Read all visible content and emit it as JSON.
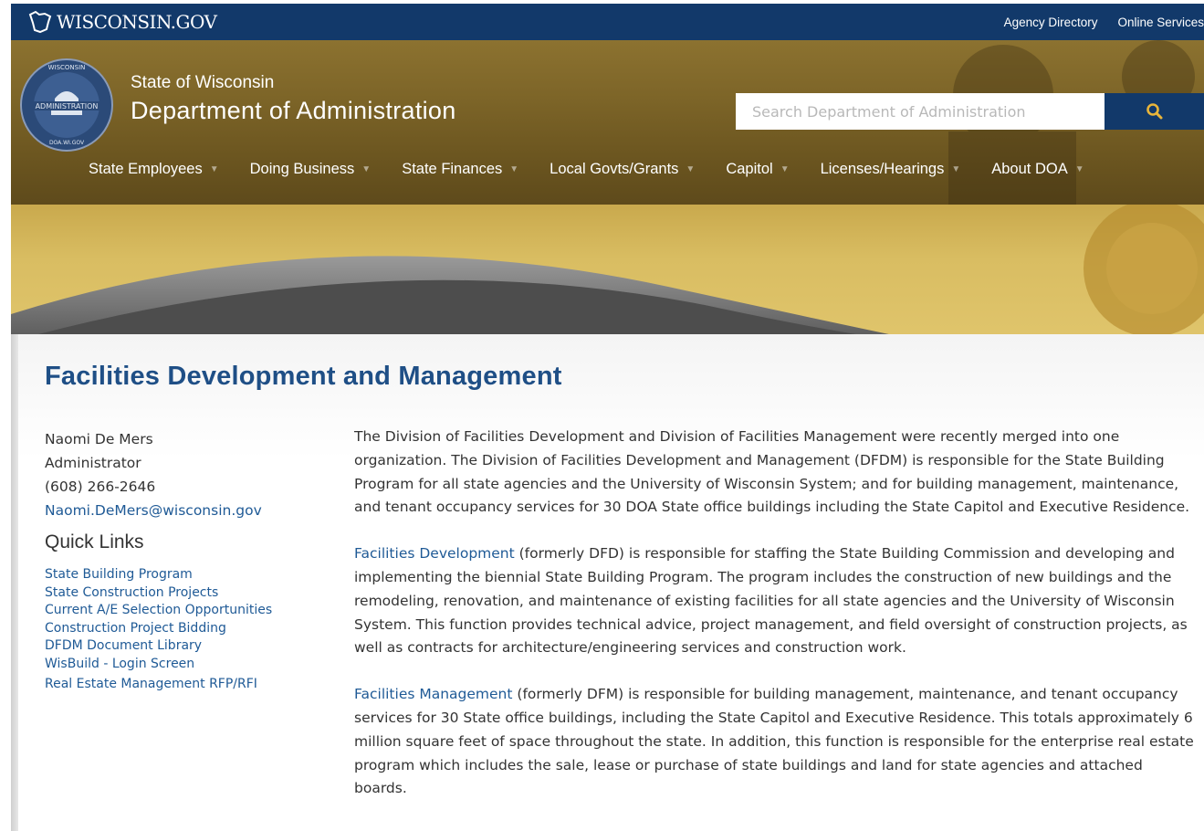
{
  "topbar": {
    "logo_text": "WISCONSIN.GOV",
    "links": [
      "Agency Directory",
      "Online Services"
    ]
  },
  "header": {
    "agency_small": "State of Wisconsin",
    "agency_big": "Department of Administration",
    "seal_text_top": "WISCONSIN",
    "seal_text_mid": "ADMINISTRATION",
    "seal_text_bottom": "DOA.WI.GOV",
    "search_placeholder": "Search Department of Administration",
    "nav": [
      {
        "label": "State Employees"
      },
      {
        "label": "Doing Business"
      },
      {
        "label": "State Finances"
      },
      {
        "label": "Local Govts/Grants"
      },
      {
        "label": "Capitol"
      },
      {
        "label": "Licenses/Hearings"
      },
      {
        "label": "About DOA"
      }
    ]
  },
  "page": {
    "title": "Facilities Development and Management"
  },
  "contact": {
    "name": "Naomi De Mers",
    "role": "Administrator",
    "phone": "(608) 266-2646",
    "email": "Naomi.DeMers@wisconsin.gov"
  },
  "quick_links": {
    "title": "Quick Links",
    "items": [
      "State Building Program",
      "State Construction Projects",
      "Current A/E Selection Opportunities",
      "Construction Project Bidding",
      "DFDM Document Library",
      "WisBuild - Login Screen",
      "Real Estate Management RFP/RFI"
    ]
  },
  "body": {
    "p1": "The Division of Facilities Development and Division of Facilities Management were recently merged into one organization. The Division of Facilities Development and Management (DFDM) is responsible for the State Building Program for all state agencies and the University of Wisconsin System; and for building management, maintenance, and tenant occupancy services for 30 DOA State office buildings including the State Capitol and Executive Residence.",
    "p2_link": "Facilities Development",
    "p2_rest": " (formerly DFD) is responsible for staffing the State Building Commission and developing and implementing the biennial State Building Program. The program includes the construction of new buildings and the remodeling, renovation, and maintenance of existing facilities for all state agencies and the University of Wisconsin System. This function provides technical advice, project management, and field oversight of construction projects, as well as contracts for architecture/engineering services and construction work.",
    "p3_link": "Facilities Management",
    "p3_rest": " (formerly DFM) is responsible for building management, maintenance, and tenant occupancy services for 30 State office buildings, including the State Capitol and Executive Residence. This totals approximately 6 million square feet of space throughout the state.  In addition, this function is responsible for the enterprise real estate program which includes the sale, lease or purchase of state buildings and land for state agencies and attached boards."
  }
}
